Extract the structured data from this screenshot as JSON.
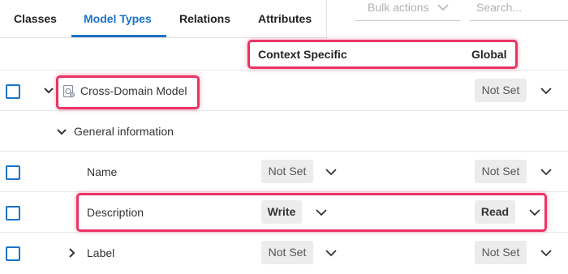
{
  "tabs": {
    "classes": "Classes",
    "model_types": "Model Types",
    "relations": "Relations",
    "attributes": "Attributes"
  },
  "toolbar": {
    "bulk_actions": "Bulk actions",
    "search_placeholder": "Search..."
  },
  "columns": {
    "context_specific": "Context Specific",
    "global": "Global"
  },
  "rows": {
    "model": {
      "label": "Cross-Domain Model",
      "global": "Not Set"
    },
    "group": {
      "label": "General information"
    },
    "name": {
      "label": "Name",
      "context": "Not Set",
      "global": "Not Set"
    },
    "description": {
      "label": "Description",
      "context": "Write",
      "global": "Read"
    },
    "label": {
      "label": "Label",
      "context": "Not Set",
      "global": "Not Set"
    }
  },
  "colors": {
    "accent": "#1a73c9",
    "highlight": "#ea3364",
    "pill_bg": "#ececec"
  }
}
